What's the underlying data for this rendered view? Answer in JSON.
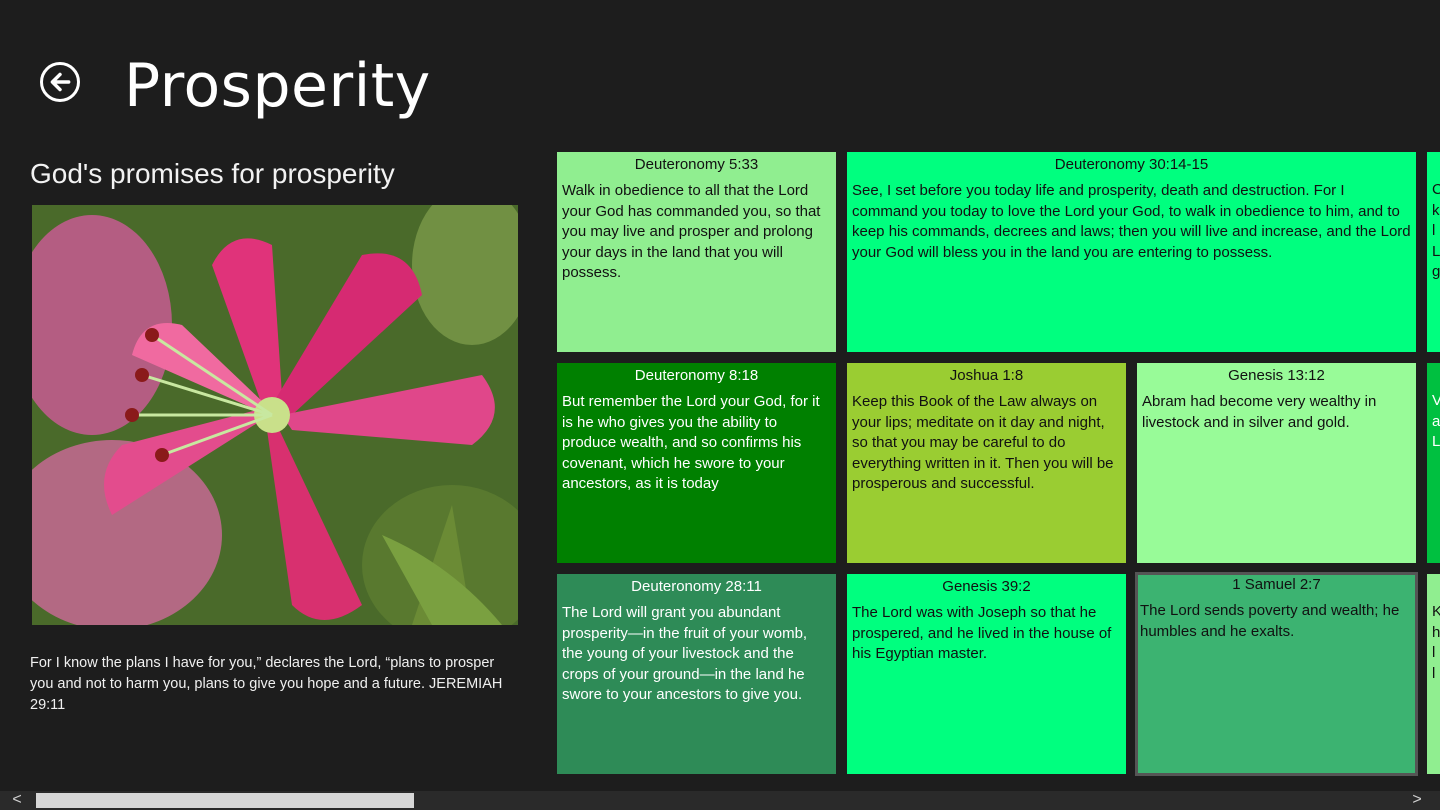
{
  "header": {
    "title": "Prosperity"
  },
  "left_panel": {
    "subtitle": "God's promises for prosperity",
    "hero_image": "pink-lily-photo",
    "quote": "For I know the plans I have for you,” declares the Lord, “plans to prosper you and not to harm you, plans to give you hope and a future. JEREMIAH 29:11"
  },
  "tiles": [
    {
      "ref": "Deuteronomy 5:33",
      "text": "Walk in obedience to all that the Lord your God has commanded you, so that you may live and prosper and prolong your days in the land that you will possess.",
      "color": "#90ee90"
    },
    {
      "ref": "Deuteronomy 30:14-15",
      "text": "See, I set before you today life and prosperity, death and destruction. For I command you today to love the Lord your God, to walk in obedience to him, and to keep his commands, decrees and laws; then you will live and increase, and the Lord your God will bless you in the land you are entering to possess.",
      "color": "#00ff7f"
    },
    {
      "ref": "Deuteronomy 8:18",
      "text": "But remember the Lord your God, for it is he who gives you the ability to produce wealth, and so confirms his covenant, which he swore to your ancestors, as it is today",
      "color": "#008000"
    },
    {
      "ref": "Joshua 1:8",
      "text": "Keep this Book of the Law always on your lips; meditate on it day and night, so that you may be careful to do everything written in it. Then you will be prosperous and successful.",
      "color": "#9acd32"
    },
    {
      "ref": "Genesis 13:12",
      "text": "Abram had become very wealthy in livestock and in silver and gold.",
      "color": "#98fb98"
    },
    {
      "ref": "Deuteronomy 28:11",
      "text": "The Lord will grant you abundant prosperity—in the fruit of your womb, the young of your livestock and the crops of your ground—in the land he swore to your ancestors to give you.",
      "color": "#2e8b57"
    },
    {
      "ref": "Genesis 39:2",
      "text": "The Lord was with Joseph so that he prospered, and he lived in the house of his Egyptian master.",
      "color": "#00ff7f"
    },
    {
      "ref": "1 Samuel 2:7",
      "text": "The Lord sends poverty and wealth; he humbles and he exalts.",
      "color": "#3cb371"
    }
  ],
  "partial_tiles": [
    {
      "text_lines": [
        "C",
        "k",
        "l",
        "L",
        "g"
      ],
      "color": "#00ff7f"
    },
    {
      "text_lines": [
        "V",
        "a",
        "L"
      ],
      "color": "#00c040"
    },
    {
      "text_lines": [
        "K",
        "h",
        "l",
        "l"
      ],
      "color": "#90ee90"
    }
  ],
  "scrollbar": {
    "left_arrow": "<",
    "right_arrow": ">"
  }
}
